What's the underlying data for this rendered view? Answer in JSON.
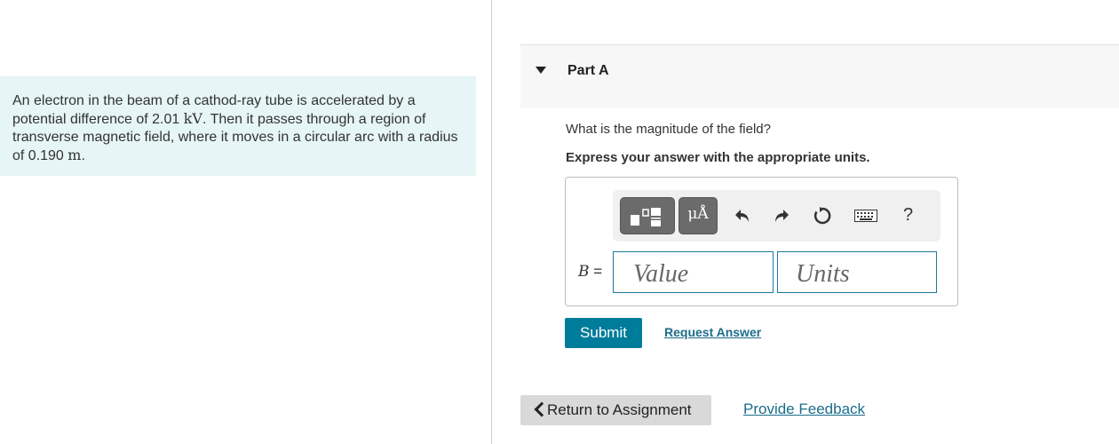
{
  "problem": {
    "text_1": "An electron in the beam of a cathod-ray tube is accelerated by a potential difference of 2.01 ",
    "unit_1": "kV",
    "text_2": ". Then it passes through a region of transverse magnetic field, where it moves in a circular arc with a radius of 0.190 ",
    "unit_2": "m",
    "text_3": "."
  },
  "part": {
    "title": "Part A",
    "question": "What is the magnitude of the field?",
    "instruction": "Express your answer with the appropriate units."
  },
  "answer": {
    "variable": "B",
    "equals": "=",
    "value_placeholder": "Value",
    "units_placeholder": "Units",
    "units_tool_glyph": "μÅ",
    "help_symbol": "?"
  },
  "toolbar_icons": [
    "templates-icon",
    "units-symbol-icon",
    "undo-icon",
    "redo-icon",
    "reset-icon",
    "keyboard-icon",
    "help-icon"
  ],
  "buttons": {
    "submit": "Submit",
    "request_answer": "Request Answer",
    "return": "Return to Assignment",
    "feedback": "Provide Feedback"
  },
  "colors": {
    "problem_bg": "#e6f5f5",
    "accent": "#007c9b",
    "link": "#1b6d8a",
    "tool_button": "#6b6b6b"
  }
}
